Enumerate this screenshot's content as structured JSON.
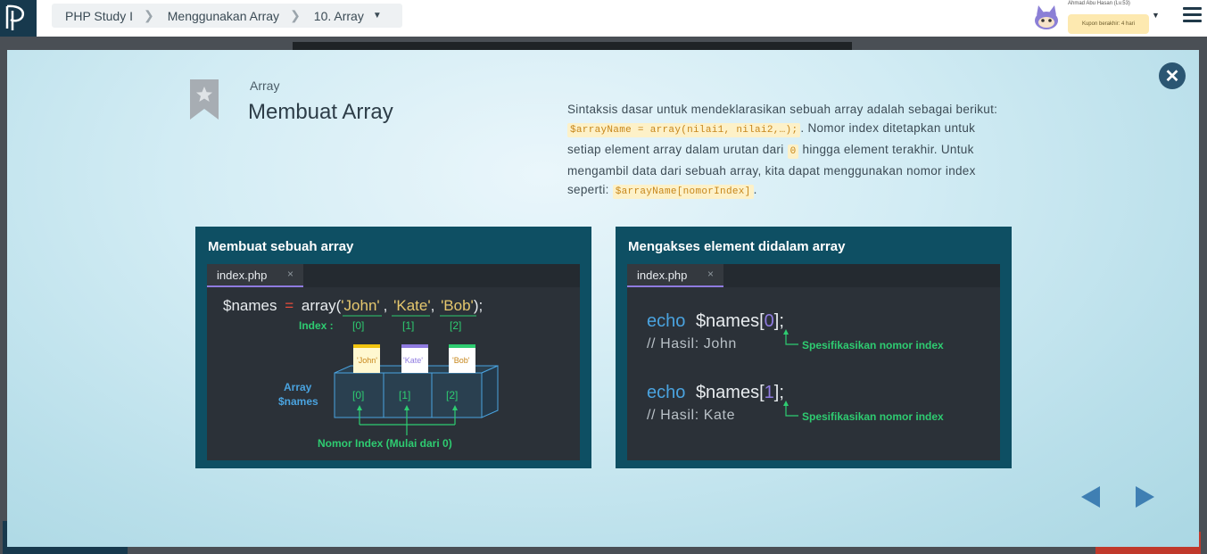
{
  "breadcrumb": {
    "course": "PHP Study I",
    "section": "Menggunakan Array",
    "lesson": "10. Array"
  },
  "user": {
    "name": "Ahmad Abu Hasan (Lv.53)",
    "coupon": "Kupon berakhir: 4 hari"
  },
  "lesson": {
    "label": "Array",
    "title": "Membuat Array",
    "desc_1": "Sintaksis dasar untuk mendeklarasikan sebuah array adalah sebagai berikut: ",
    "code_1": "$arrayName = array(nilai1, nilai2,…);",
    "desc_2": ". Nomor index ditetapkan untuk setiap element array dalam urutan dari ",
    "code_2": "0",
    "desc_3": " hingga element terakhir. Untuk mengambil data dari sebuah array, kita dapat menggunakan nomor index seperti: ",
    "code_3": "$arrayName[nomorIndex]",
    "desc_4": "."
  },
  "panel_left": {
    "title": "Membuat sebuah array",
    "tab": "index.php",
    "tab_close": "×",
    "code_var": "$names",
    "code_eq": "=",
    "code_fn": "array(",
    "code_v1": "'John'",
    "code_v2": "'Kate'",
    "code_v3": "'Bob'",
    "code_end": ");",
    "index_label": "Index :",
    "idx0": "[0]",
    "idx1": "[1]",
    "idx2": "[2]",
    "card1": "'John'",
    "card2": "'Kate'",
    "card3": "'Bob'",
    "array_label_1": "Array",
    "array_label_2": "$names",
    "footer": "Nomor Index (Mulai dari 0)"
  },
  "panel_right": {
    "title": "Mengakses element didalam array",
    "tab": "index.php",
    "tab_close": "×",
    "echo": "echo",
    "var": "$names",
    "idx0": "0",
    "idx1": "1",
    "result1": "// Hasil: John",
    "result2": "// Hasil: Kate",
    "note": "Spesifikasikan nomor index"
  },
  "colors": {
    "brand_dark": "#17394d",
    "panel_bg": "#0e4f63",
    "editor_bg": "#2b3138",
    "code_green": "#2ecc71",
    "code_yellow": "#e6c86e",
    "code_blue": "#4aa3df",
    "tab_accent": "#8f7be0"
  },
  "icons": [
    "logo-icon",
    "chevron-right-icon",
    "caret-down-icon",
    "avatar-icon",
    "hamburger-menu-icon",
    "close-icon",
    "bookmark-star-icon",
    "prev-arrow-icon",
    "next-arrow-icon"
  ]
}
